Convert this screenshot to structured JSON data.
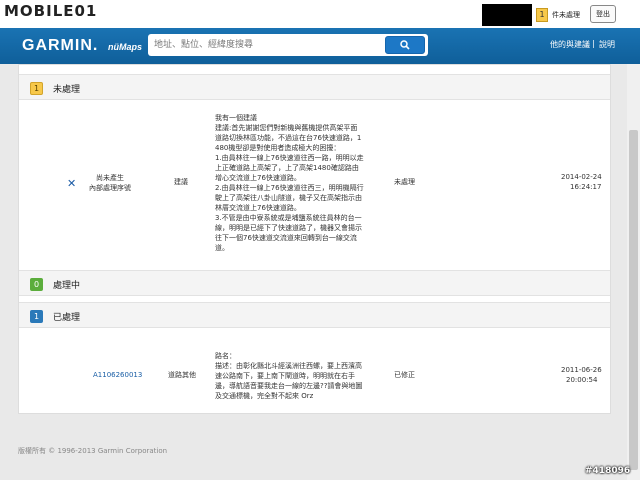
{
  "topbar": {
    "site_logo": "MOBILE01",
    "unhandled_count": "1",
    "unhandled_label": "件未處理",
    "logout_label": "登出"
  },
  "header": {
    "brand": "GARMIN.",
    "brand_sub": "nüMaps",
    "search_placeholder": "地址、點位、經緯度搜尋",
    "apps_link": "他的與建議",
    "separator": "|",
    "help_link": "說明"
  },
  "sections": [
    {
      "count": "1",
      "title": "未處理",
      "color": "#f7c84a"
    },
    {
      "count": "0",
      "title": "處理中",
      "color": "#5bad3c"
    },
    {
      "count": "1",
      "title": "已處理",
      "color": "#2a79b9"
    }
  ],
  "reports": [
    {
      "id_label": "尚未產生\n內部處理序號",
      "category": "建議",
      "content_lines": [
        "我有一個建議",
        "建議:首先謝謝您們對新機與舊機提供高架平面",
        "道路切換林區功能，不過這在台76快速道路，1",
        "480機型卻是對使用者造成極大的困擾：",
        "1.由員林往一線上76快速道往西一路，明明以走",
        "上正確道路上高架了，上了高架1480確認路由",
        "增心交流道上76快速道路。",
        "2.由員林往一線上76快速道往西三，明明機隔行",
        "駛上了高架往八卦山隧道，機子又在高架指示由",
        "林厝交流道上76快速道路。",
        "3.不管是由中寮系統或是埔鹽系統往員林的台一",
        "線，明明是已經下了快速道路了，機器又會揚示",
        "往下一個76快速道交流道來回轉到台一線交流",
        "道。"
      ],
      "status": "未處理",
      "date": "2014-02-24",
      "time": "16:24:17"
    },
    {
      "id_label": "A1106260013",
      "category": "道路其他",
      "content_lines": [
        "路名：",
        "描述：由彰化縣北斗經溪洲往西螺，要上西濱高",
        "速公路南下，要上南下閘道時，明明就在右手",
        "邊，導航語音要我走台一線的左邊??請會與地圖",
        "及交通標機，完全對不起來 Orz"
      ],
      "status": "已修正",
      "date": "2011-06-26",
      "time": "20:00:54"
    }
  ],
  "footer": {
    "copyright": "版權所有 © 1996-2013 Garmin Corporation"
  },
  "watermark": "#418096"
}
